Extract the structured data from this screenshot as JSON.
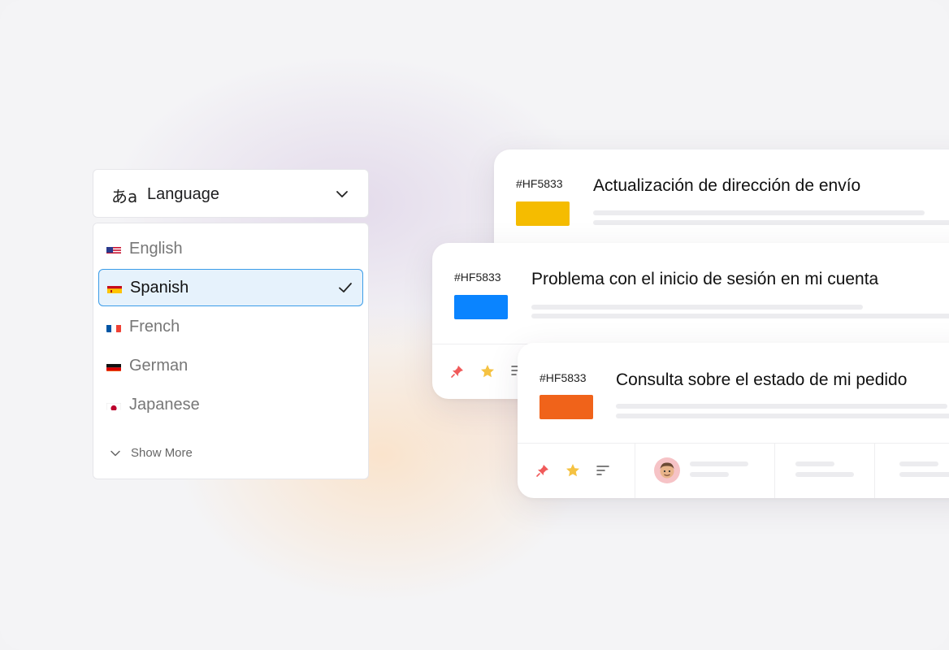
{
  "language_picker": {
    "icon": "hiragana-a-icon",
    "icon_text": "あa",
    "title": "Language",
    "options": [
      {
        "label": "English",
        "flag": "us-flag-icon",
        "selected": false
      },
      {
        "label": "Spanish",
        "flag": "es-flag-icon",
        "selected": true
      },
      {
        "label": "French",
        "flag": "fr-flag-icon",
        "selected": false
      },
      {
        "label": "German",
        "flag": "de-flag-icon",
        "selected": false
      },
      {
        "label": "Japanese",
        "flag": "jp-flag-icon",
        "selected": false
      }
    ],
    "show_more_label": "Show More"
  },
  "tickets": [
    {
      "id": "#HF5833",
      "title": "Actualización de dirección de envío",
      "color": "#F5BC00"
    },
    {
      "id": "#HF5833",
      "title": "Problema con el inicio de sesión en mi cuenta",
      "color": "#0A84FF"
    },
    {
      "id": "#HF5833",
      "title": "Consulta sobre el estado de mi pedido",
      "color": "#F0631A"
    }
  ],
  "colors": {
    "accent": "#3B9CE8",
    "selected_bg": "#E6F2FC",
    "pin": "#F05A5A",
    "star": "#F5C242"
  }
}
